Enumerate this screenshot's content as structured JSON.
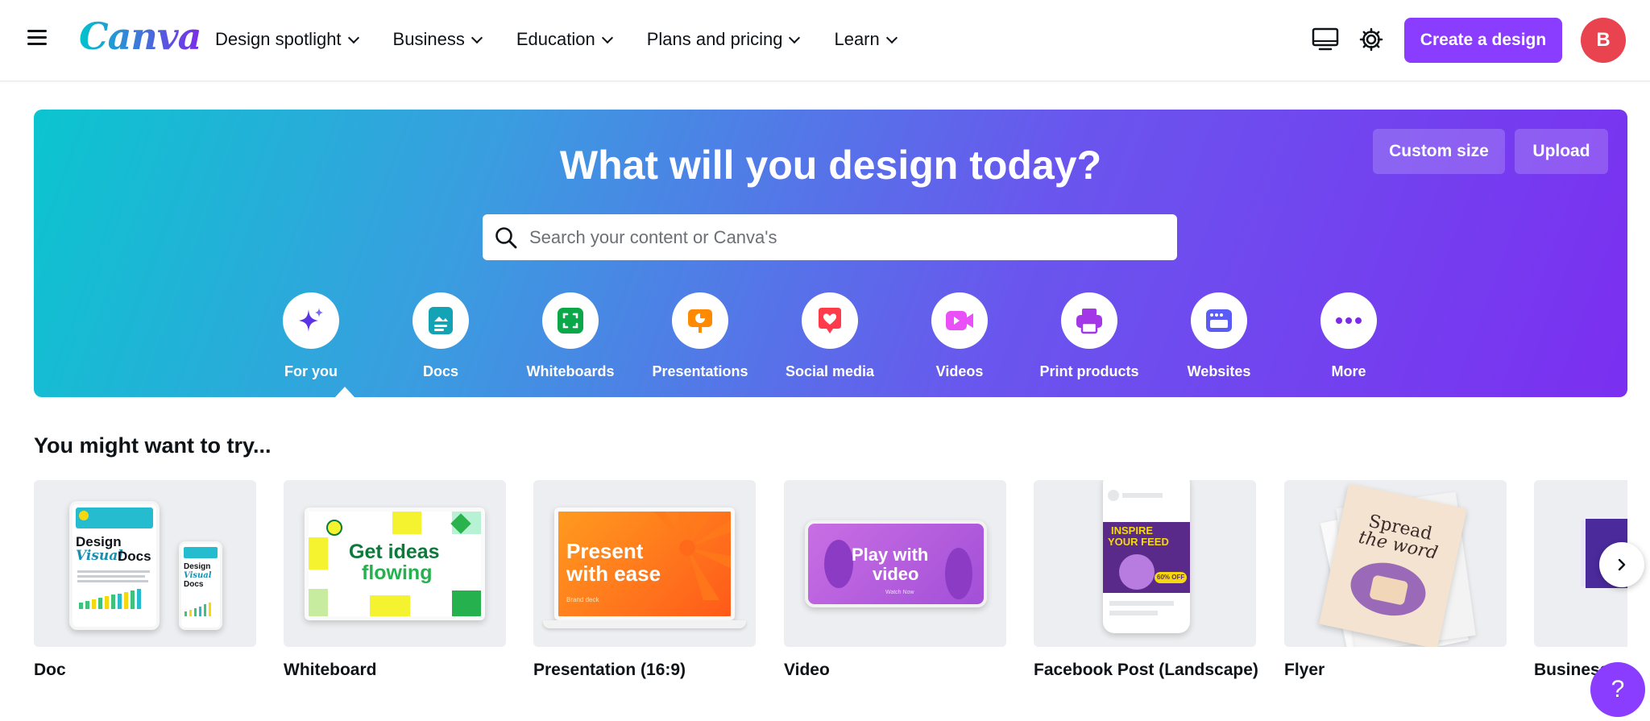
{
  "nav": {
    "logo": "Canva",
    "links": [
      "Design spotlight",
      "Business",
      "Education",
      "Plans and pricing",
      "Learn"
    ],
    "create_label": "Create a design",
    "avatar_initial": "B"
  },
  "hero": {
    "title": "What will you design today?",
    "custom_size_label": "Custom size",
    "upload_label": "Upload",
    "search_placeholder": "Search your content or Canva's",
    "categories": [
      {
        "label": "For you",
        "icon": "sparkle-icon",
        "color": "#7d2ae8"
      },
      {
        "label": "Docs",
        "icon": "doc-icon",
        "color": "#13a3b5"
      },
      {
        "label": "Whiteboards",
        "icon": "whiteboard-icon",
        "color": "#0ba84a"
      },
      {
        "label": "Presentations",
        "icon": "presentation-icon",
        "color": "#ff8a00"
      },
      {
        "label": "Social media",
        "icon": "heart-icon",
        "color": "#ff3b4b"
      },
      {
        "label": "Videos",
        "icon": "video-icon",
        "color": "#e950f7"
      },
      {
        "label": "Print products",
        "icon": "printer-icon",
        "color": "#a336e6"
      },
      {
        "label": "Websites",
        "icon": "website-icon",
        "color": "#5b5cf6"
      },
      {
        "label": "More",
        "icon": "more-icon",
        "color": "#7d2ae8"
      }
    ]
  },
  "try": {
    "title": "You might want to try...",
    "cards": [
      {
        "label": "Doc",
        "art": [
          "Design",
          "Visual",
          "Docs"
        ]
      },
      {
        "label": "Whiteboard",
        "art": [
          "Get ideas",
          "flowing"
        ]
      },
      {
        "label": "Presentation (16:9)",
        "art": [
          "Present",
          "with ease",
          "Brand deck"
        ]
      },
      {
        "label": "Video",
        "art": [
          "Play with",
          "video",
          "Watch Now"
        ]
      },
      {
        "label": "Facebook Post (Landscape)",
        "art": [
          "INSPIRE",
          "YOUR FEED",
          "60% OFF"
        ]
      },
      {
        "label": "Flyer",
        "art": [
          "Spread",
          "the word"
        ]
      },
      {
        "label": "Business",
        "art": []
      }
    ]
  },
  "help_label": "?"
}
